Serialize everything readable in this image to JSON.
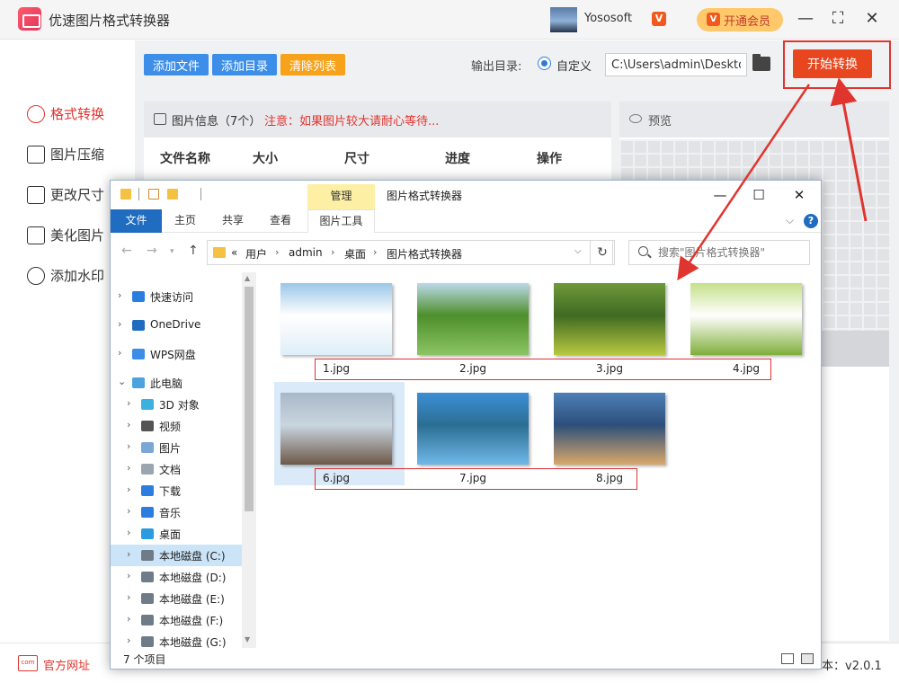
{
  "app": {
    "title": "优速图片格式转换器",
    "user_name": "Yososoft",
    "vip_button": "开通会员",
    "vip_badge": "V",
    "minimize": "—",
    "maximize": "⛶",
    "close": "✕"
  },
  "sidebar": {
    "items": [
      {
        "label": "格式转换",
        "icon": "format-convert-icon",
        "active": true
      },
      {
        "label": "图片压缩",
        "icon": "compress-icon"
      },
      {
        "label": "更改尺寸",
        "icon": "resize-icon"
      },
      {
        "label": "美化图片",
        "icon": "beautify-icon"
      },
      {
        "label": "添加水印",
        "icon": "watermark-icon"
      }
    ]
  },
  "toolbar": {
    "add_file": "添加文件",
    "add_dir": "添加目录",
    "clear_list": "清除列表",
    "output_label": "输出目录:",
    "radio_label": "自定义",
    "output_path": "C:\\Users\\admin\\Desktop",
    "start": "开始转换"
  },
  "info": {
    "title": "图片信息（7个）",
    "notice": "注意：如果图片较大请耐心等待...",
    "columns": [
      "文件名称",
      "大小",
      "尺寸",
      "进度",
      "操作"
    ]
  },
  "preview": {
    "title": "预览"
  },
  "bottom": {
    "site_icon": "com",
    "site_link": "官方网址",
    "version": "本：v2.0.1"
  },
  "explorer": {
    "manage_tab": "管理",
    "title": "图片格式转换器",
    "ribbon_tabs": [
      "文件",
      "主页",
      "共享",
      "查看"
    ],
    "tools_tab": "图片工具",
    "help": "?",
    "breadcrumbs": [
      "«",
      "用户",
      "admin",
      "桌面",
      "图片格式转换器"
    ],
    "search_placeholder": "搜索\"图片格式转换器\"",
    "nav_items": [
      {
        "label": "快速访问",
        "icon": "star-icon",
        "color": "#2b7de0",
        "indent": 0
      },
      {
        "label": "OneDrive",
        "icon": "cloud-icon",
        "color": "#1f6cc0",
        "indent": 0
      },
      {
        "label": "WPS网盘",
        "icon": "cloud-icon",
        "color": "#3b8de8",
        "indent": 0
      },
      {
        "label": "此电脑",
        "icon": "computer-icon",
        "color": "#4aa3df",
        "indent": 0,
        "expanded": true
      },
      {
        "label": "3D 对象",
        "icon": "cube-icon",
        "color": "#3cb0e0",
        "indent": 1
      },
      {
        "label": "视频",
        "icon": "video-icon",
        "color": "#555555",
        "indent": 1
      },
      {
        "label": "图片",
        "icon": "picture-icon",
        "color": "#7aa7d6",
        "indent": 1
      },
      {
        "label": "文档",
        "icon": "document-icon",
        "color": "#9aa5b1",
        "indent": 1
      },
      {
        "label": "下载",
        "icon": "download-icon",
        "color": "#2b7de0",
        "indent": 1
      },
      {
        "label": "音乐",
        "icon": "music-icon",
        "color": "#2b7de0",
        "indent": 1
      },
      {
        "label": "桌面",
        "icon": "desktop-icon",
        "color": "#2b9be0",
        "indent": 1
      },
      {
        "label": "本地磁盘 (C:)",
        "icon": "drive-icon",
        "color": "#6f7c88",
        "indent": 1,
        "selected": true
      },
      {
        "label": "本地磁盘 (D:)",
        "icon": "drive-icon",
        "color": "#6f7c88",
        "indent": 1
      },
      {
        "label": "本地磁盘 (E:)",
        "icon": "drive-icon",
        "color": "#6f7c88",
        "indent": 1
      },
      {
        "label": "本地磁盘 (F:)",
        "icon": "drive-icon",
        "color": "#6f7c88",
        "indent": 1
      },
      {
        "label": "本地磁盘 (G:)",
        "icon": "drive-icon",
        "color": "#6f7c88",
        "indent": 1
      }
    ],
    "files": [
      {
        "name": "1.jpg",
        "colors": [
          "#9ac7e8",
          "#dfeef8",
          "#ffffff"
        ]
      },
      {
        "name": "2.jpg",
        "colors": [
          "#bcd9ea",
          "#8cc464",
          "#4d8f2a"
        ]
      },
      {
        "name": "3.jpg",
        "colors": [
          "#6f9a3a",
          "#b8c840",
          "#3f6a22"
        ]
      },
      {
        "name": "4.jpg",
        "colors": [
          "#c5e08a",
          "#7fae3a",
          "#ffffff"
        ]
      },
      {
        "name": "6.jpg",
        "colors": [
          "#a9b8c8",
          "#6e5848",
          "#c9d6e0"
        ],
        "selected": true
      },
      {
        "name": "7.jpg",
        "colors": [
          "#3c8fd6",
          "#6fb8e8",
          "#2b6e92"
        ]
      },
      {
        "name": "8.jpg",
        "colors": [
          "#4d7fb8",
          "#d9a86a",
          "#2c4f7a"
        ]
      }
    ],
    "item_count": "7 个项目"
  }
}
